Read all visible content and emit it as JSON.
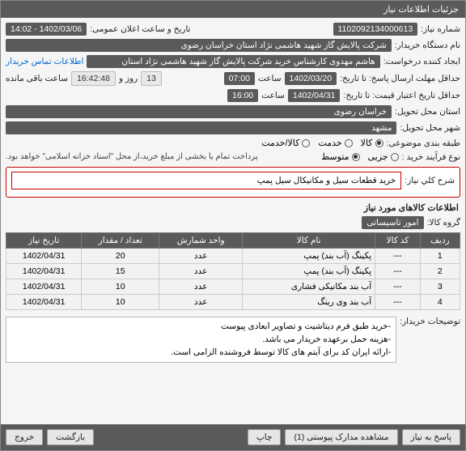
{
  "title_bar": "جزئیات اطلاعات نیاز",
  "labels": {
    "need_number": "شماره نیاز:",
    "announce_datetime": "تاریخ و ساعت اعلان عمومی:",
    "buyer_org": "نام دستگاه خریدار:",
    "requester": "ایجاد کننده درخواست:",
    "contact_info": "اطلاعات تماس خریدار",
    "deadline": "حداقل مهلت ارسال پاسخ: تا تاریخ:",
    "hour": "ساعت",
    "days_remain_prefix": "",
    "days_remain_suffix": "روز و",
    "time_remain_suffix": "ساعت باقی مانده",
    "validity_until": "حداقل تاریخ اعتبار قیمت: تا تاریخ:",
    "province": "استان محل تحویل:",
    "city": "شهر محل تحویل:",
    "category": "طبقه بندی موضوعی:",
    "purchase_type": "نوع فرآیند خرید :",
    "size": "",
    "payment_note": "پرداخت تمام یا بخشی از مبلغ خرید،از محل \"اسناد خزانه اسلامی\" خواهد بود.",
    "need_desc": "شرح کلي نياز:",
    "items_info": "اطلاعات کالاهای مورد نیاز",
    "goods_group": "گروه کالا:",
    "buyer_notes": "توضیحات خریدار:"
  },
  "values": {
    "need_number": "1102092134000613",
    "announce_datetime": "1402/03/06 - 14:02",
    "buyer_org": "شرکت پالایش گاز شهید هاشمی نژاد   استان خراسان رضوی",
    "requester": "هاشم مهدوی کارشناس خرید شرکت پالایش گاز شهید هاشمی نژاد   استان",
    "deadline_date": "1402/03/20",
    "deadline_time": "07:00",
    "days_remain": "13",
    "time_remain": "16:42:48",
    "validity_date": "1402/04/31",
    "validity_time": "16:00",
    "province": "خراسان رضوی",
    "city": "مشهد",
    "goods_group": "امور تاسیساتی",
    "need_desc": "خرید قطعات سیل و مکانیکال سیل پمپ"
  },
  "category_options": {
    "goods": "کالا",
    "service": "خدمت",
    "both": "کالا/خدمت"
  },
  "purchase_options": {
    "small": "جزیی",
    "medium": "متوسط"
  },
  "table": {
    "headers": {
      "row": "ردیف",
      "code": "کد کالا",
      "name": "نام کالا",
      "unit": "واحد شمارش",
      "qty": "تعداد / مقدار",
      "date": "تاریخ نیاز"
    },
    "rows": [
      {
        "row": "1",
        "code": "---",
        "name": "پکینگ (آب بند) پمپ",
        "unit": "عدد",
        "qty": "20",
        "date": "1402/04/31"
      },
      {
        "row": "2",
        "code": "---",
        "name": "پکینگ (آب بند) پمپ",
        "unit": "عدد",
        "qty": "15",
        "date": "1402/04/31"
      },
      {
        "row": "3",
        "code": "---",
        "name": "آب بند مکانیکی فشاری",
        "unit": "عدد",
        "qty": "10",
        "date": "1402/04/31"
      },
      {
        "row": "4",
        "code": "---",
        "name": "آب بند وی رینگ",
        "unit": "عدد",
        "qty": "10",
        "date": "1402/04/31"
      }
    ]
  },
  "buyer_notes_lines": [
    "-خرید طبق فرم دیتاشیت و تصاویر ابعادی پیوست",
    "-هزینه حمل برعهده خریدار می باشد.",
    "-ارائه ایران کد برای آیتم های کالا توسط فروشنده الزامی است."
  ],
  "footer": {
    "respond": "پاسخ به نیاز",
    "view_docs": "مشاهده مدارک پیوستی (1)",
    "print": "چاپ",
    "back": "بازگشت",
    "exit": "خروج"
  }
}
